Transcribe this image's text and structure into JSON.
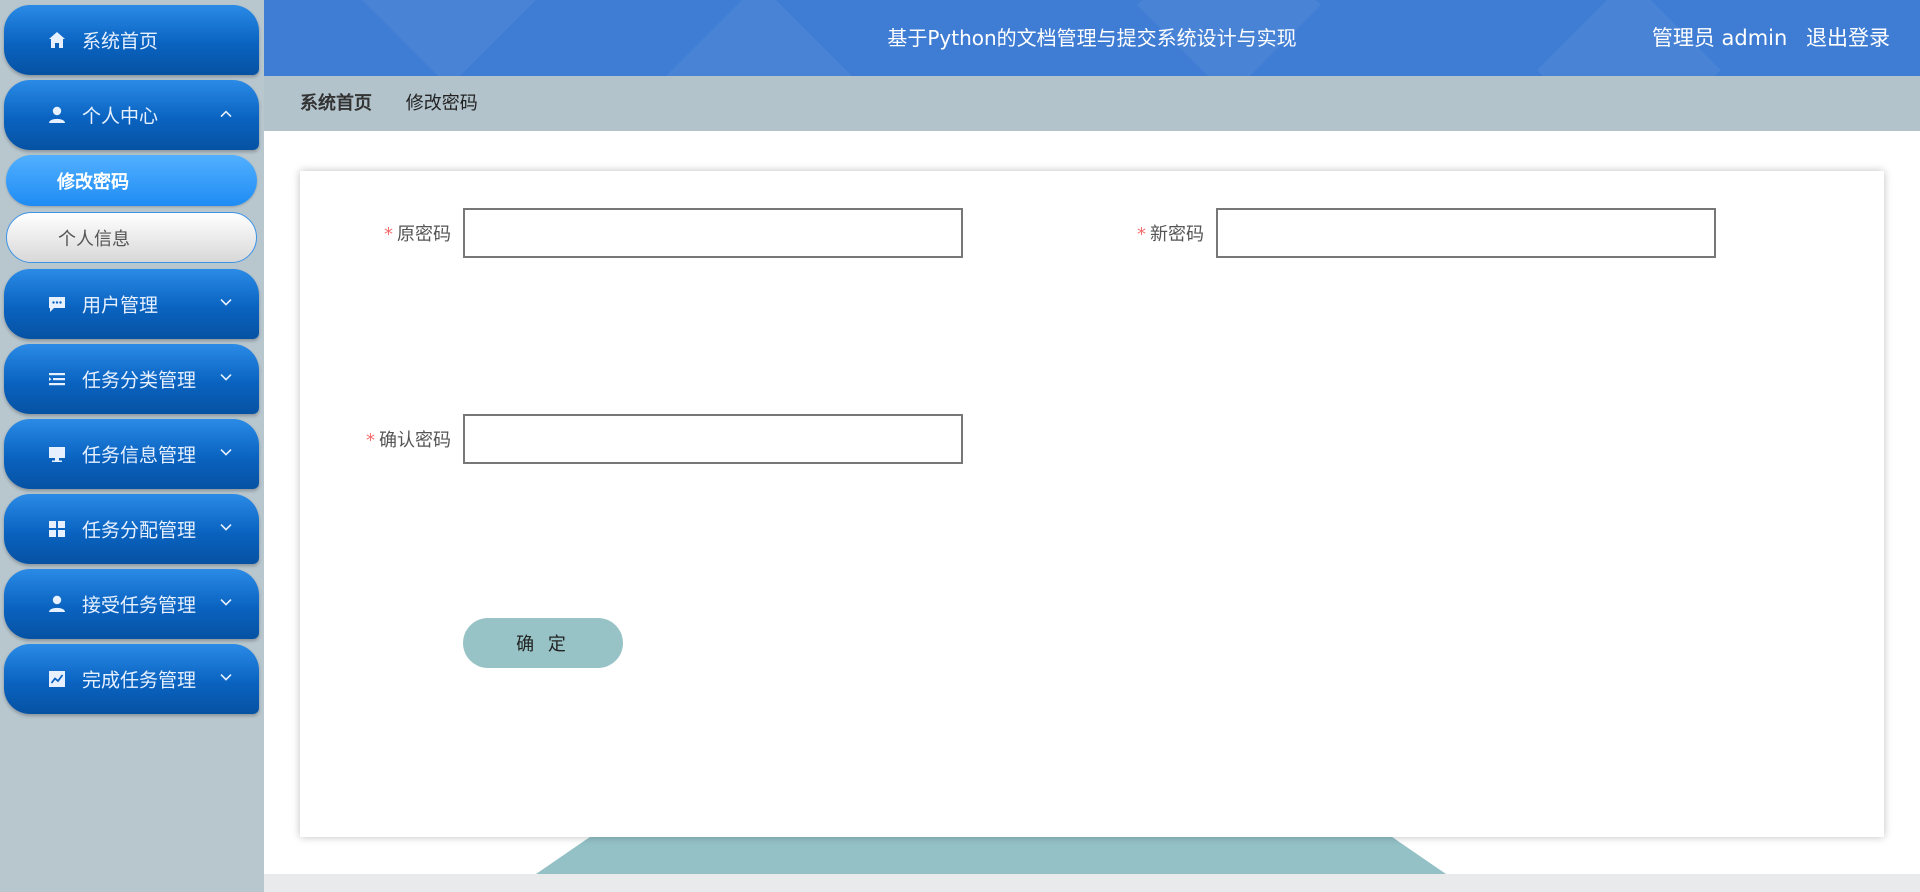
{
  "header": {
    "title": "基于Python的文档管理与提交系统设计与实现",
    "user_label": "管理员 admin",
    "logout_label": "退出登录"
  },
  "sidebar": {
    "items": [
      {
        "label": "系统首页",
        "icon": "home-icon"
      },
      {
        "label": "个人中心",
        "icon": "user-icon",
        "expanded": true,
        "children": [
          {
            "label": "修改密码",
            "active": true
          },
          {
            "label": "个人信息",
            "active": false
          }
        ]
      },
      {
        "label": "用户管理",
        "icon": "chat-icon"
      },
      {
        "label": "任务分类管理",
        "icon": "list-icon"
      },
      {
        "label": "任务信息管理",
        "icon": "monitor-icon"
      },
      {
        "label": "任务分配管理",
        "icon": "grid-icon"
      },
      {
        "label": "接受任务管理",
        "icon": "user-icon"
      },
      {
        "label": "完成任务管理",
        "icon": "chart-icon"
      }
    ]
  },
  "breadcrumb": {
    "home": "系统首页",
    "current": "修改密码"
  },
  "form": {
    "required_mark": "*",
    "old_password_label": "原密码",
    "old_password_value": "",
    "new_password_label": "新密码",
    "new_password_value": "",
    "confirm_password_label": "确认密码",
    "confirm_password_value": "",
    "submit_label": "确 定"
  },
  "colors": {
    "header_bg": "#3f7dd4",
    "menu_gradient_top": "#2a8be6",
    "menu_gradient_bottom": "#0652a3",
    "submit_button": "#97c3c6",
    "required_star": "#f56c6c"
  }
}
